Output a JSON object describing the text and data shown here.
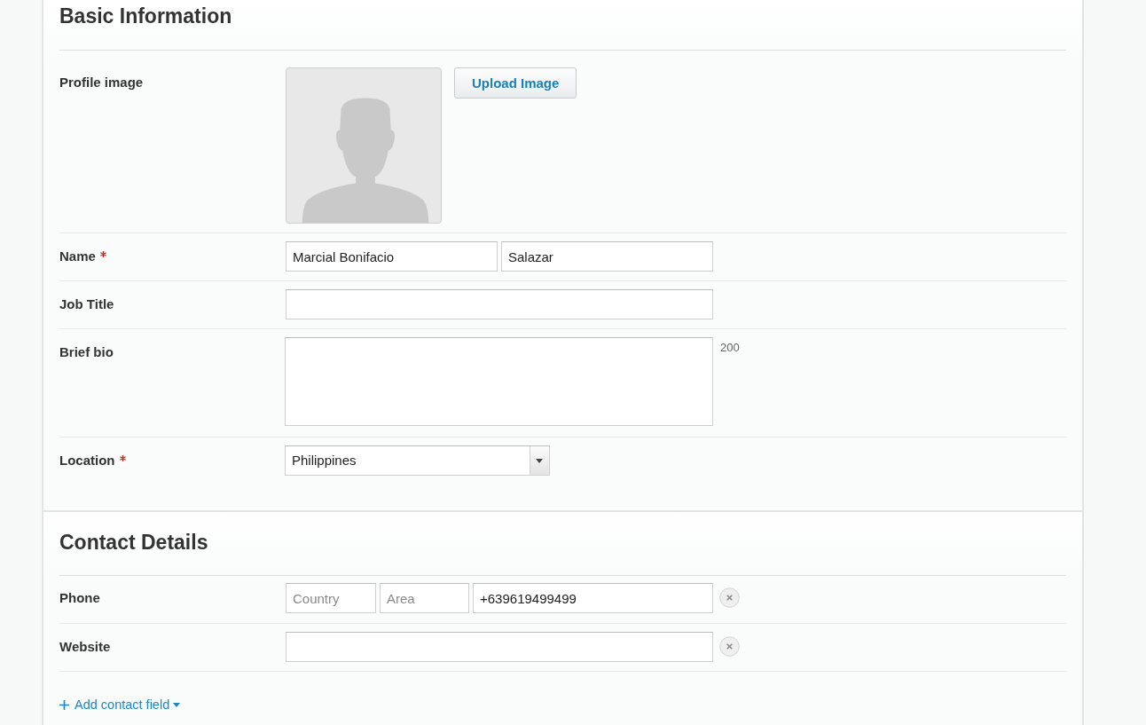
{
  "sections": [
    {
      "title": "Basic Information",
      "rows": [
        {
          "kind": "image",
          "label": "Profile image",
          "required": false,
          "button": "Upload Image"
        },
        {
          "kind": "split",
          "label": "Name",
          "required": true,
          "fields": [
            {
              "value": "Marcial Bonifacio"
            },
            {
              "value": "Salazar"
            }
          ]
        },
        {
          "kind": "text",
          "label": "Job Title",
          "required": false
        },
        {
          "kind": "textarea",
          "label": "Brief bio",
          "required": false,
          "counter": "200"
        },
        {
          "kind": "select",
          "label": "Location",
          "required": true,
          "value": "Philippines"
        }
      ]
    },
    {
      "title": "Contact Details",
      "rows": [
        {
          "kind": "phone",
          "label": "Phone",
          "removable": true,
          "fields": [
            {
              "placeholder": "Country"
            },
            {
              "placeholder": "Area"
            },
            {
              "value": "+639619499499"
            }
          ]
        },
        {
          "kind": "text",
          "label": "Website",
          "removable": true
        }
      ],
      "add_link": {
        "label": "Add contact field"
      }
    }
  ]
}
